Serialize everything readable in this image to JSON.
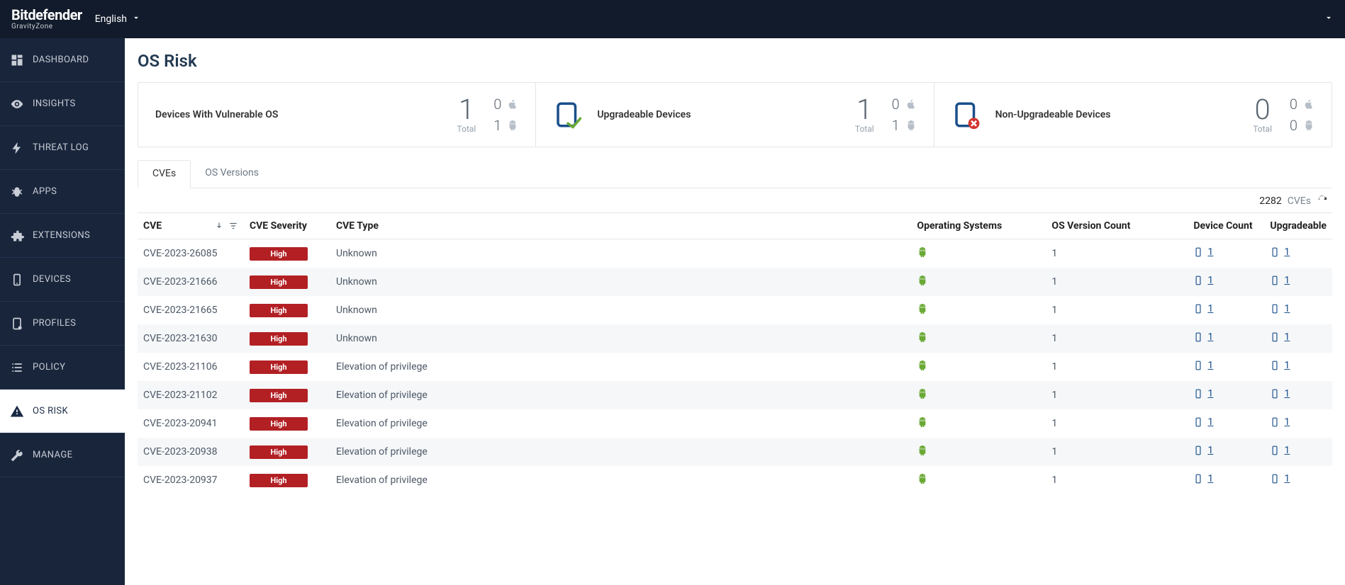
{
  "header": {
    "brand": "Bitdefender",
    "sub_brand": "GravityZone",
    "language": "English"
  },
  "sidebar": {
    "items": [
      {
        "id": "dashboard",
        "label": "DASHBOARD",
        "icon": "dashboard"
      },
      {
        "id": "insights",
        "label": "INSIGHTS",
        "icon": "eye"
      },
      {
        "id": "threat-log",
        "label": "THREAT LOG",
        "icon": "bolt"
      },
      {
        "id": "apps",
        "label": "APPS",
        "icon": "bug"
      },
      {
        "id": "extensions",
        "label": "EXTENSIONS",
        "icon": "puzzle"
      },
      {
        "id": "devices",
        "label": "DEVICES",
        "icon": "device"
      },
      {
        "id": "profiles",
        "label": "PROFILES",
        "icon": "profile"
      },
      {
        "id": "policy",
        "label": "POLICY",
        "icon": "list"
      },
      {
        "id": "os-risk",
        "label": "OS RISK",
        "icon": "warning",
        "active": true
      },
      {
        "id": "manage",
        "label": "MANAGE",
        "icon": "wrench"
      }
    ]
  },
  "page": {
    "title": "OS Risk",
    "stats": {
      "vulnerable": {
        "label": "Devices With Vulnerable OS",
        "total": 1,
        "total_label": "Total",
        "apple": 0,
        "android": 1
      },
      "upgradeable": {
        "label": "Upgradeable Devices",
        "total": 1,
        "total_label": "Total",
        "apple": 0,
        "android": 1
      },
      "non_upgradeable": {
        "label": "Non-Upgradeable Devices",
        "total": 0,
        "total_label": "Total",
        "apple": 0,
        "android": 0
      }
    },
    "tabs": [
      {
        "id": "cves",
        "label": "CVEs",
        "active": true
      },
      {
        "id": "os-versions",
        "label": "OS Versions"
      }
    ],
    "count": {
      "value": 2282,
      "label": "CVEs"
    },
    "table": {
      "columns": {
        "cve": "CVE",
        "severity": "CVE Severity",
        "type": "CVE Type",
        "os": "Operating Systems",
        "version_count": "OS Version Count",
        "device_count": "Device Count",
        "upgradeable": "Upgradeable"
      },
      "rows": [
        {
          "cve": "CVE-2023-26085",
          "severity": "High",
          "type": "Unknown",
          "os": "android",
          "version_count": 1,
          "device_count": 1,
          "upgradeable": 1
        },
        {
          "cve": "CVE-2023-21666",
          "severity": "High",
          "type": "Unknown",
          "os": "android",
          "version_count": 1,
          "device_count": 1,
          "upgradeable": 1
        },
        {
          "cve": "CVE-2023-21665",
          "severity": "High",
          "type": "Unknown",
          "os": "android",
          "version_count": 1,
          "device_count": 1,
          "upgradeable": 1
        },
        {
          "cve": "CVE-2023-21630",
          "severity": "High",
          "type": "Unknown",
          "os": "android",
          "version_count": 1,
          "device_count": 1,
          "upgradeable": 1
        },
        {
          "cve": "CVE-2023-21106",
          "severity": "High",
          "type": "Elevation of privilege",
          "os": "android",
          "version_count": 1,
          "device_count": 1,
          "upgradeable": 1
        },
        {
          "cve": "CVE-2023-21102",
          "severity": "High",
          "type": "Elevation of privilege",
          "os": "android",
          "version_count": 1,
          "device_count": 1,
          "upgradeable": 1
        },
        {
          "cve": "CVE-2023-20941",
          "severity": "High",
          "type": "Elevation of privilege",
          "os": "android",
          "version_count": 1,
          "device_count": 1,
          "upgradeable": 1
        },
        {
          "cve": "CVE-2023-20938",
          "severity": "High",
          "type": "Elevation of privilege",
          "os": "android",
          "version_count": 1,
          "device_count": 1,
          "upgradeable": 1
        },
        {
          "cve": "CVE-2023-20937",
          "severity": "High",
          "type": "Elevation of privilege",
          "os": "android",
          "version_count": 1,
          "device_count": 1,
          "upgradeable": 1
        }
      ]
    }
  }
}
